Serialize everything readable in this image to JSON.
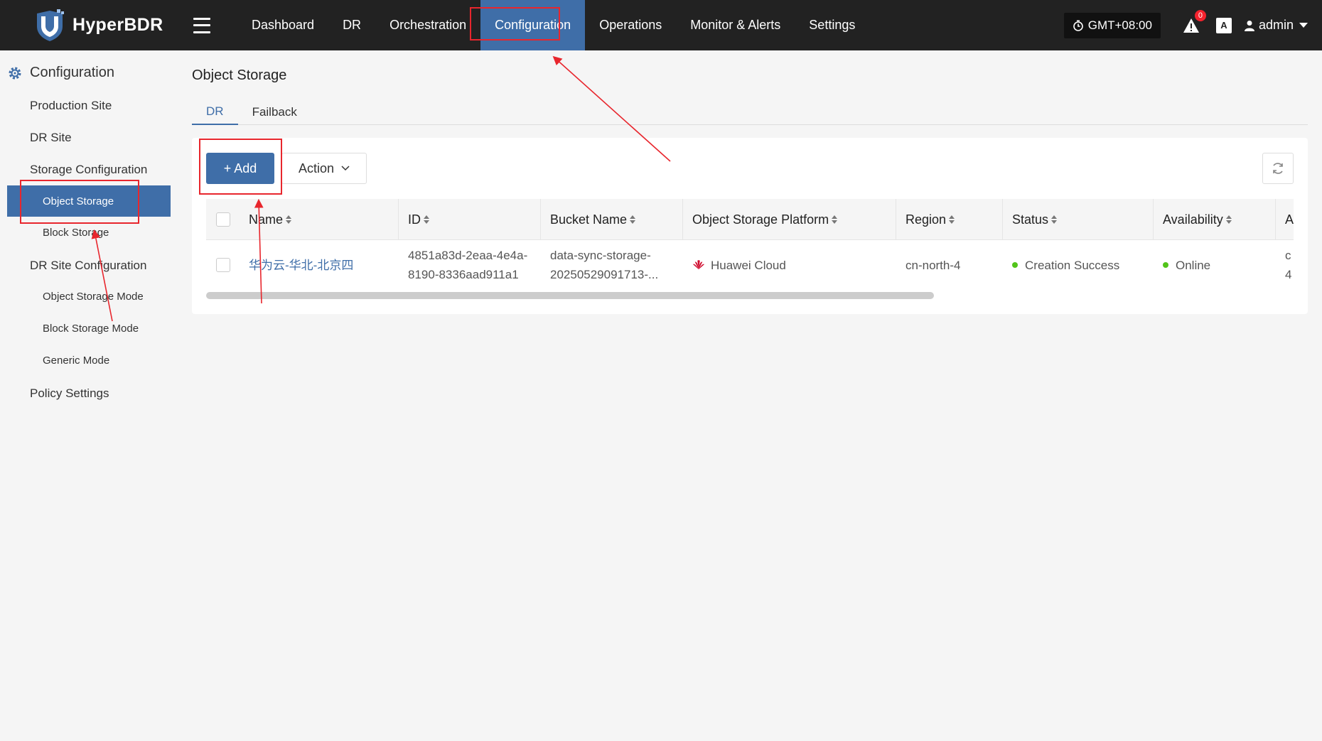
{
  "app": {
    "name": "HyperBDR"
  },
  "nav": {
    "items": [
      "Dashboard",
      "DR",
      "Orchestration",
      "Configuration",
      "Operations",
      "Monitor & Alerts",
      "Settings"
    ],
    "active": "Configuration"
  },
  "top_right": {
    "timezone": "GMT+08:00",
    "alerts_count": "0",
    "lang_icon": "A",
    "user": "admin"
  },
  "sidebar": {
    "title": "Configuration",
    "production_site": "Production Site",
    "dr_site": "DR Site",
    "storage_configuration": "Storage Configuration",
    "object_storage": "Object Storage",
    "block_storage": "Block Storage",
    "dr_site_configuration": "DR Site Configuration",
    "object_storage_mode": "Object Storage Mode",
    "block_storage_mode": "Block Storage Mode",
    "generic_mode": "Generic Mode",
    "policy_settings": "Policy Settings"
  },
  "page": {
    "title": "Object Storage",
    "tabs": [
      "DR",
      "Failback"
    ],
    "active_tab": "DR"
  },
  "toolbar": {
    "add_label": "+ Add",
    "action_label": "Action"
  },
  "table": {
    "columns": [
      "Name",
      "ID",
      "Bucket Name",
      "Object Storage Platform",
      "Region",
      "Status",
      "Availability",
      "A"
    ],
    "rows": [
      {
        "name": "华为云-华北-北京四",
        "id_line1": "4851a83d-2eaa-4e4a-",
        "id_line2": "8190-8336aad911a1",
        "bucket_line1": "data-sync-storage-",
        "bucket_line2": "20250529091713-...",
        "platform": "Huawei Cloud",
        "region": "cn-north-4",
        "status": "Creation Success",
        "availability": "Online",
        "extra_line1": "c",
        "extra_line2": "4"
      }
    ]
  },
  "colors": {
    "accent": "#3f6ea8",
    "topbar": "#222222",
    "success": "#52c41a",
    "annotation": "#e8262d",
    "huawei": "#cf0a2c"
  }
}
